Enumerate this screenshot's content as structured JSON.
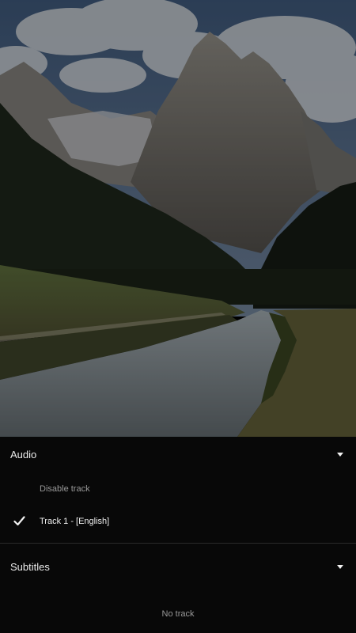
{
  "audio": {
    "title": "Audio",
    "toggle_icon": "caret-down-icon",
    "options": [
      {
        "label": "Disable track",
        "selected": false
      },
      {
        "label": "Track 1 - [English]",
        "selected": true
      }
    ]
  },
  "subtitles": {
    "title": "Subtitles",
    "toggle_icon": "caret-down-icon",
    "empty_label": "No track"
  },
  "colors": {
    "sheet_background": "#0a0a0a",
    "text_primary": "#ececec",
    "text_muted": "#9a9a9a"
  }
}
